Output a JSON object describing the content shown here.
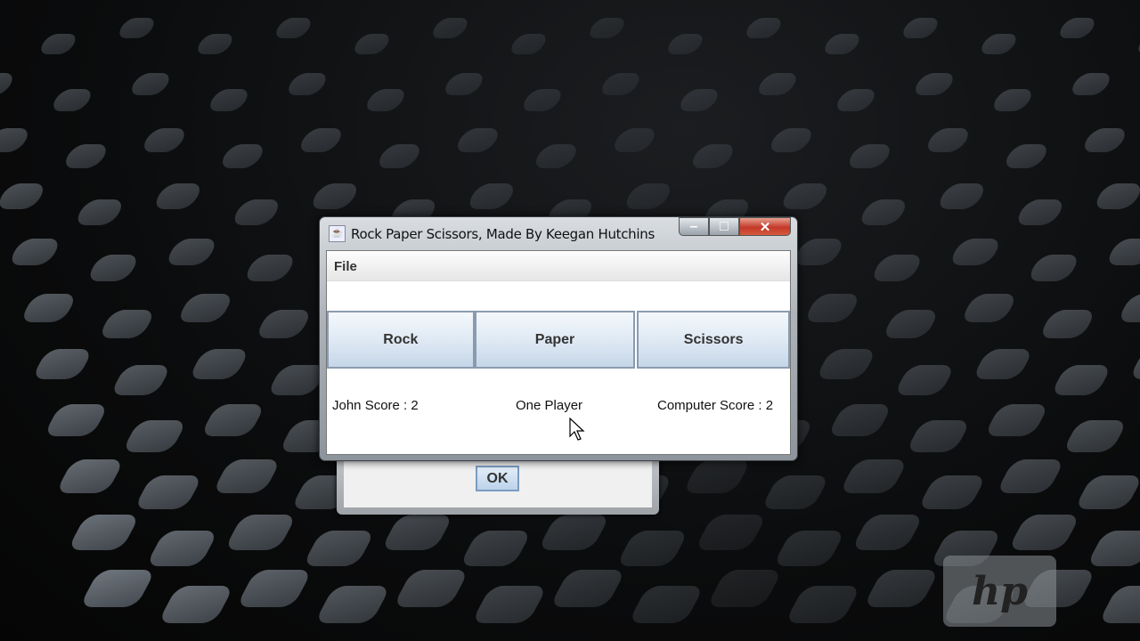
{
  "window": {
    "title": "Rock Paper Scissors, Made By Keegan Hutchins",
    "minimize": "–",
    "maximize": "□",
    "close": "✕"
  },
  "menu": {
    "file": "File"
  },
  "buttons": {
    "rock": "Rock",
    "paper": "Paper",
    "scissors": "Scissors"
  },
  "status": {
    "player_score": "John Score : 2",
    "mode": "One Player",
    "computer_score": "Computer Score : 2"
  },
  "dialog": {
    "ok": "OK"
  },
  "watermark": {
    "logo": "hp"
  }
}
